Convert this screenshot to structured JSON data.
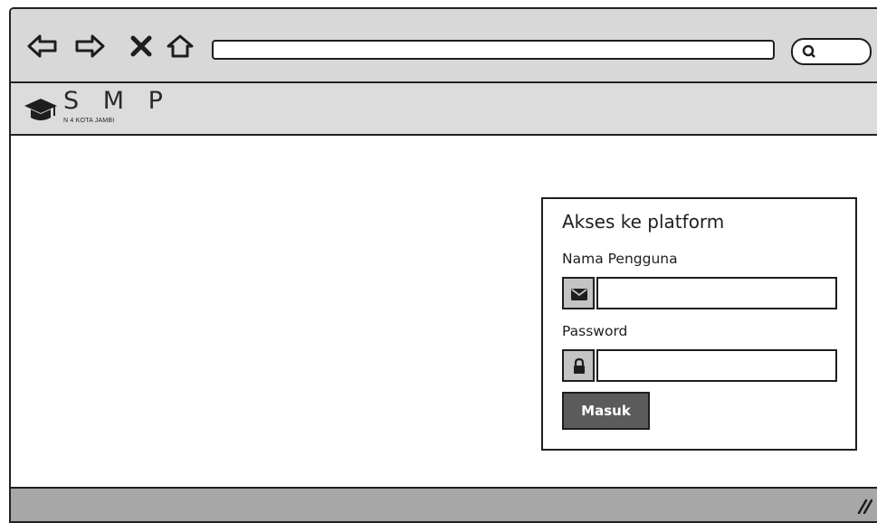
{
  "browser": {
    "nav_icons": [
      "back-arrow-icon",
      "forward-arrow-icon",
      "close-icon",
      "home-icon"
    ],
    "address_value": "",
    "search_value": ""
  },
  "app": {
    "logo_icon": "graduation-cap-icon",
    "logo_title": "S M P",
    "logo_subtitle": "N 4 KOTA JAMBI"
  },
  "login": {
    "title": "Akses ke platform",
    "username_label": "Nama Pengguna",
    "username_icon": "envelope-icon",
    "username_value": "",
    "password_label": "Password",
    "password_icon": "lock-icon",
    "password_value": "",
    "submit_label": "Masuk"
  },
  "colors": {
    "toolbar_bg": "#d8d8d8",
    "appbar_bg": "#dcdcdc",
    "button_bg": "#5b5b5b",
    "statusbar_bg": "#a7a7a7",
    "stroke": "#1e1e1e"
  }
}
